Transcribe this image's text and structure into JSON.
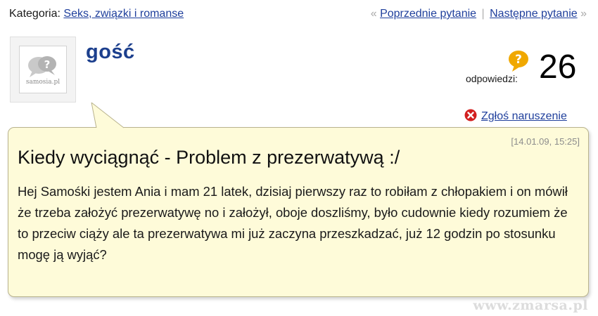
{
  "breadcrumb": {
    "category_label": "Kategoria:",
    "category_link": "Seks, związki i romanse"
  },
  "pager": {
    "prev_chevron": "«",
    "prev_label": "Poprzednie pytanie",
    "separator": "|",
    "next_label": "Następne pytanie",
    "next_chevron": "»"
  },
  "user": {
    "name": "gość",
    "avatar_brand": "samosia.pl"
  },
  "answers": {
    "label": "odpowiedzi:",
    "count": "26",
    "icon": "question-bubble-icon",
    "icon_color": "#f0a800"
  },
  "report": {
    "icon": "close-circle-icon",
    "icon_color": "#d21f1f",
    "label": "Zgłoś naruszenie"
  },
  "question": {
    "timestamp": "[14.01.09, 15:25]",
    "title": "Kiedy wyciągnąć - Problem z prezerwatywą :/",
    "body": "Hej Samośki jestem Ania i mam 21 latek, dzisiaj pierwszy raz to robiłam z chłopakiem i on mówił że trzeba założyć prezerwatywę no i założył, oboje doszliśmy, było cudownie kiedy rozumiem że to przeciw ciąży ale ta prezerwatywa mi już zaczyna przeszkadzać, już 12 godzin po stosunku mogę ją wyjąć?"
  },
  "watermark": "www.zmarsa.pl",
  "colors": {
    "link": "#1f3f9c",
    "username": "#1c3f8d",
    "bubble_bg": "#fefbd9",
    "bubble_border": "#b9b38d"
  }
}
